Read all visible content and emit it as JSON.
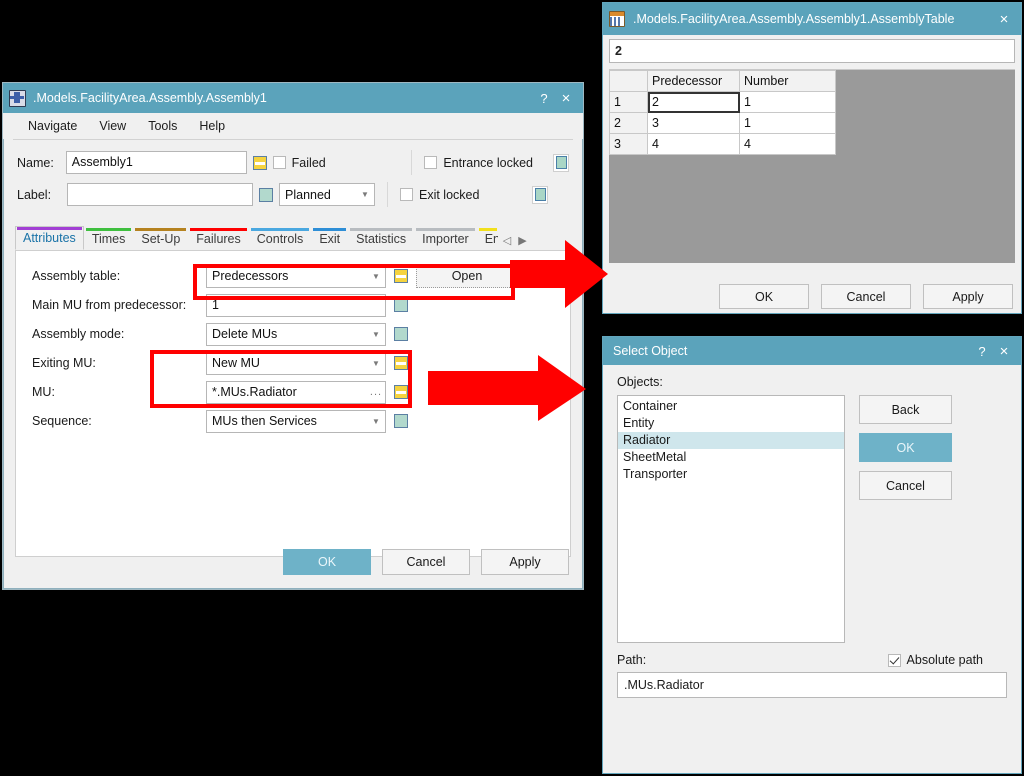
{
  "main_window": {
    "title": ".Models.FacilityArea.Assembly.Assembly1",
    "icon": "assembly-icon",
    "help_btn": "?",
    "close_btn": "×",
    "menu": [
      "Navigate",
      "View",
      "Tools",
      "Help"
    ],
    "fields": {
      "name_label": "Name:",
      "name_value": "Assembly1",
      "label_label": "Label:",
      "label_value": "",
      "failed_label": "Failed",
      "planned_value": "Planned",
      "entrance_locked_label": "Entrance locked",
      "exit_locked_label": "Exit locked"
    },
    "tabs": [
      {
        "label": "Attributes",
        "color": "#a23fd4",
        "active": true
      },
      {
        "label": "Times",
        "color": "#3fbf3f",
        "active": false
      },
      {
        "label": "Set-Up",
        "color": "#b5821f",
        "active": false
      },
      {
        "label": "Failures",
        "color": "#ff0000",
        "active": false
      },
      {
        "label": "Controls",
        "color": "#4aa8e0",
        "active": false
      },
      {
        "label": "Exit",
        "color": "#2e8ed6",
        "active": false
      },
      {
        "label": "Statistics",
        "color": "#b8bcc0",
        "active": false
      },
      {
        "label": "Importer",
        "color": "#b8bcc0",
        "active": false
      },
      {
        "label": "En",
        "color": "#f2e01c",
        "active": false
      }
    ],
    "tab_scroll_prev": "◁",
    "tab_scroll_next": "▶",
    "attributes": [
      {
        "label": "Assembly table:",
        "value": "Predecessors",
        "type": "combo",
        "toggle": "yellow"
      },
      {
        "label": "Main MU from predecessor:",
        "value": "1",
        "type": "text",
        "toggle": "green"
      },
      {
        "label": "Assembly mode:",
        "value": "Delete MUs",
        "type": "combo",
        "toggle": "green"
      },
      {
        "label": "Exiting MU:",
        "value": "New MU",
        "type": "combo",
        "toggle": "yellow"
      },
      {
        "label": "MU:",
        "value": "*.MUs.Radiator",
        "type": "browse",
        "toggle": "yellow"
      },
      {
        "label": "Sequence:",
        "value": "MUs then Services",
        "type": "combo",
        "toggle": "green"
      }
    ],
    "open_button": "Open",
    "browse_ellipsis": "...",
    "buttons": {
      "ok": "OK",
      "cancel": "Cancel",
      "apply": "Apply"
    }
  },
  "table_window": {
    "title": ".Models.FacilityArea.Assembly.Assembly1.AssemblyTable",
    "icon": "table-icon",
    "close_btn": "×",
    "formula_value": "2",
    "columns": [
      "Predecessor",
      "Number"
    ],
    "rows": [
      {
        "header": "1",
        "cells": [
          "2",
          "1"
        ]
      },
      {
        "header": "2",
        "cells": [
          "3",
          "1"
        ]
      },
      {
        "header": "3",
        "cells": [
          "4",
          "4"
        ]
      }
    ],
    "selected_cell": {
      "row": 0,
      "col": 0
    },
    "buttons": {
      "ok": "OK",
      "cancel": "Cancel",
      "apply": "Apply"
    }
  },
  "select_object_window": {
    "title": "Select Object",
    "help_btn": "?",
    "close_btn": "×",
    "objects_label": "Objects:",
    "objects": [
      "Container",
      "Entity",
      "Radiator",
      "SheetMetal",
      "Transporter"
    ],
    "selected_object": "Radiator",
    "buttons": {
      "back": "Back",
      "ok": "OK",
      "cancel": "Cancel"
    },
    "path_label": "Path:",
    "absolute_path_label": "Absolute path",
    "absolute_path_checked": true,
    "path_value": ".MUs.Radiator"
  },
  "annotations": {
    "highlight_color": "#ff0000",
    "arrow_color": "#ff0000",
    "arrow_count": 2
  },
  "theme": {
    "titlebar_color": "#5ba3bb",
    "window_bg": "#f0f0f0",
    "primary_button": "#6eb2c8",
    "selection": "#cfe6ec",
    "page_bg": "#000000"
  }
}
